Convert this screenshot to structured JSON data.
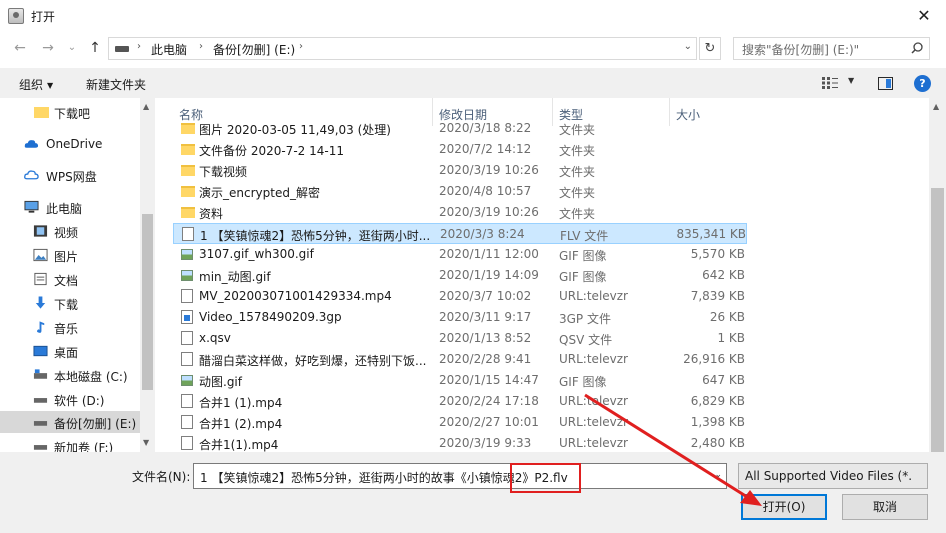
{
  "window": {
    "title": "打开",
    "close": "✕"
  },
  "nav": {
    "back": "←",
    "forward": "→",
    "dropdown": "⌄",
    "up": "↑"
  },
  "address": {
    "crumbs": [
      "此电脑",
      "备份[勿删] (E:)"
    ],
    "separator": "›",
    "dropdown": "⌄",
    "refresh": "↻"
  },
  "search": {
    "placeholder": "搜索\"备份[勿删] (E:)\""
  },
  "toolbar": {
    "organize": "组织",
    "new_folder": "新建文件夹",
    "caret": "▼",
    "help": "?"
  },
  "sidebar": {
    "items": [
      {
        "label": "下载吧",
        "icon": "folder-icon"
      },
      {
        "label": "OneDrive",
        "icon": "cloud-icon"
      },
      {
        "label": "WPS网盘",
        "icon": "cloud-icon"
      },
      {
        "label": "此电脑",
        "icon": "computer-icon"
      },
      {
        "label": "视频",
        "icon": "video-folder-icon"
      },
      {
        "label": "图片",
        "icon": "picture-folder-icon"
      },
      {
        "label": "文档",
        "icon": "document-folder-icon"
      },
      {
        "label": "下载",
        "icon": "download-icon"
      },
      {
        "label": "音乐",
        "icon": "music-icon"
      },
      {
        "label": "桌面",
        "icon": "desktop-icon"
      },
      {
        "label": "本地磁盘 (C:)",
        "icon": "drive-icon"
      },
      {
        "label": "软件 (D:)",
        "icon": "drive-icon"
      },
      {
        "label": "备份[勿删] (E:)",
        "icon": "drive-icon"
      },
      {
        "label": "新加卷 (F:)",
        "icon": "drive-icon"
      }
    ],
    "scroll_up": "▲",
    "scroll_down": "▼"
  },
  "columns": {
    "name": "名称",
    "date": "修改日期",
    "type": "类型",
    "size": "大小",
    "sort_caret": "^"
  },
  "files": [
    {
      "name": "图片 2020-03-05 11,49,03 (处理)",
      "date": "2020/3/18 8:22",
      "type": "文件夹",
      "size": "",
      "icon": "folder"
    },
    {
      "name": "文件备份 2020-7-2 14-11",
      "date": "2020/7/2 14:12",
      "type": "文件夹",
      "size": "",
      "icon": "folder"
    },
    {
      "name": "下载视频",
      "date": "2020/3/19 10:26",
      "type": "文件夹",
      "size": "",
      "icon": "folder"
    },
    {
      "name": "演示_encrypted_解密",
      "date": "2020/4/8 10:57",
      "type": "文件夹",
      "size": "",
      "icon": "folder"
    },
    {
      "name": "资料",
      "date": "2020/3/19 10:26",
      "type": "文件夹",
      "size": "",
      "icon": "folder"
    },
    {
      "name": "1 【笑镇惊魂2】恐怖5分钟，逛街两小时...",
      "date": "2020/3/3 8:24",
      "type": "FLV 文件",
      "size": "835,341 KB",
      "icon": "doc"
    },
    {
      "name": "3107.gif_wh300.gif",
      "date": "2020/1/11 12:00",
      "type": "GIF 图像",
      "size": "5,570 KB",
      "icon": "img"
    },
    {
      "name": "min_动图.gif",
      "date": "2020/1/19 14:09",
      "type": "GIF 图像",
      "size": "642 KB",
      "icon": "img"
    },
    {
      "name": "MV_202003071001429334.mp4",
      "date": "2020/3/7 10:02",
      "type": "URL:televzr",
      "size": "7,839 KB",
      "icon": "doc"
    },
    {
      "name": "Video_1578490209.3gp",
      "date": "2020/3/11 9:17",
      "type": "3GP 文件",
      "size": "26 KB",
      "icon": "vid"
    },
    {
      "name": "x.qsv",
      "date": "2020/1/13 8:52",
      "type": "QSV 文件",
      "size": "1 KB",
      "icon": "doc"
    },
    {
      "name": "醋溜白菜这样做，好吃到爆，还特别下饭...",
      "date": "2020/2/28 9:41",
      "type": "URL:televzr",
      "size": "26,916 KB",
      "icon": "doc"
    },
    {
      "name": "动图.gif",
      "date": "2020/1/15 14:47",
      "type": "GIF 图像",
      "size": "647 KB",
      "icon": "img"
    },
    {
      "name": "合并1 (1).mp4",
      "date": "2020/2/24 17:18",
      "type": "URL:televzr",
      "size": "6,829 KB",
      "icon": "doc"
    },
    {
      "name": "合并1 (2).mp4",
      "date": "2020/2/27 10:01",
      "type": "URL:televzr",
      "size": "1,398 KB",
      "icon": "doc"
    },
    {
      "name": "合并1(1).mp4",
      "date": "2020/3/19 9:33",
      "type": "URL:televzr",
      "size": "2,480 KB",
      "icon": "doc"
    }
  ],
  "selected_row": 5,
  "footer": {
    "filename_label": "文件名(N):",
    "filename_value": "1 【笑镇惊魂2】恐怖5分钟，逛街两小时的故事《小镇惊魂2》P2.flv",
    "filter_value": "All Supported Video Files (*.",
    "open_label": "打开(O)",
    "cancel_label": "取消",
    "dropdown": "⌄"
  },
  "colors": {
    "accent": "#0078d7",
    "selection": "#cce8ff",
    "annotation": "#e01f1f"
  }
}
